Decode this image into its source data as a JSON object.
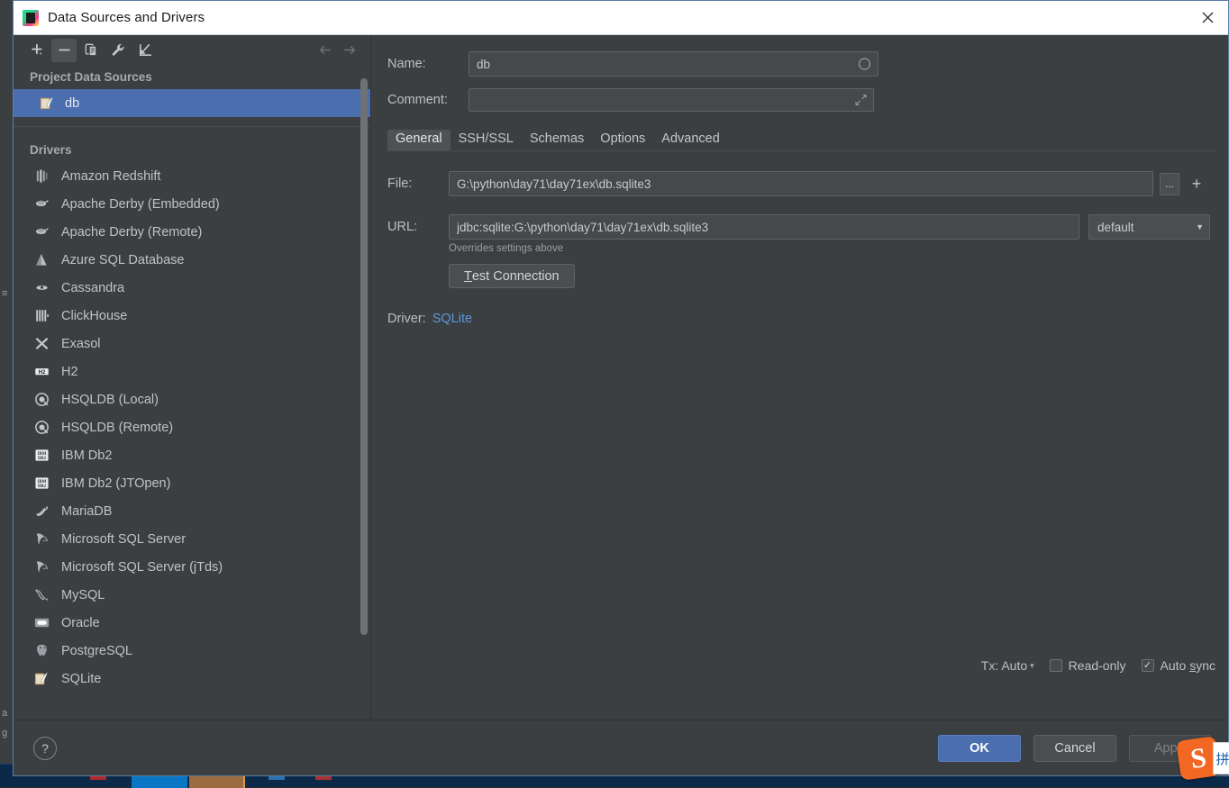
{
  "window": {
    "title": "Data Sources and Drivers",
    "app_icon": "pycharm-icon",
    "close_icon": "close-icon"
  },
  "toolbar": {
    "buttons": [
      {
        "name": "add-data-source-button",
        "icon": "plus-icon",
        "label": "+"
      },
      {
        "name": "remove-data-source-button",
        "icon": "minus-icon",
        "label": "−"
      },
      {
        "name": "duplicate-data-source-button",
        "icon": "copy-icon",
        "label": "copy"
      },
      {
        "name": "properties-button",
        "icon": "wrench-icon",
        "label": "wrench"
      },
      {
        "name": "import-data-source-button",
        "icon": "import-arrow-icon",
        "label": "import"
      }
    ],
    "back_icon": "arrow-left-icon",
    "forward_icon": "arrow-right-icon"
  },
  "sidebar": {
    "project_group_label": "Project Data Sources",
    "data_sources": [
      {
        "label": "db",
        "icon": "sqlite-icon",
        "selected": true
      }
    ],
    "drivers_group_label": "Drivers",
    "drivers": [
      {
        "label": "Amazon Redshift",
        "icon": "redshift-icon"
      },
      {
        "label": "Apache Derby (Embedded)",
        "icon": "derby-icon"
      },
      {
        "label": "Apache Derby (Remote)",
        "icon": "derby-icon"
      },
      {
        "label": "Azure SQL Database",
        "icon": "azure-icon"
      },
      {
        "label": "Cassandra",
        "icon": "cassandra-icon"
      },
      {
        "label": "ClickHouse",
        "icon": "clickhouse-icon"
      },
      {
        "label": "Exasol",
        "icon": "exasol-icon"
      },
      {
        "label": "H2",
        "icon": "h2-icon"
      },
      {
        "label": "HSQLDB (Local)",
        "icon": "hsqldb-icon"
      },
      {
        "label": "HSQLDB (Remote)",
        "icon": "hsqldb-icon"
      },
      {
        "label": "IBM Db2",
        "icon": "db2-icon"
      },
      {
        "label": "IBM Db2 (JTOpen)",
        "icon": "db2-icon"
      },
      {
        "label": "MariaDB",
        "icon": "mariadb-icon"
      },
      {
        "label": "Microsoft SQL Server",
        "icon": "mssql-icon"
      },
      {
        "label": "Microsoft SQL Server (jTds)",
        "icon": "mssql-icon"
      },
      {
        "label": "MySQL",
        "icon": "mysql-icon"
      },
      {
        "label": "Oracle",
        "icon": "oracle-icon"
      },
      {
        "label": "PostgreSQL",
        "icon": "postgresql-icon"
      },
      {
        "label": "SQLite",
        "icon": "sqlite-icon"
      }
    ]
  },
  "form": {
    "name_label": "Name:",
    "name_value": "db",
    "name_placeholder": "",
    "comment_label": "Comment:",
    "comment_value": "",
    "comment_placeholder": "",
    "tabs": [
      {
        "label": "General",
        "active": true
      },
      {
        "label": "SSH/SSL",
        "active": false
      },
      {
        "label": "Schemas",
        "active": false
      },
      {
        "label": "Options",
        "active": false
      },
      {
        "label": "Advanced",
        "active": false
      }
    ],
    "file_label": "File:",
    "file_value": "G:\\python\\day71\\day71ex\\db.sqlite3",
    "file_browse_label": "...",
    "file_add_label": "+",
    "url_label": "URL:",
    "url_value": "jdbc:sqlite:G:\\python\\day71\\day71ex\\db.sqlite3",
    "url_mode_value": "default",
    "url_hint": "Overrides settings above",
    "test_connection_label": "Test Connection",
    "test_connection_mnemonic": "T",
    "driver_label": "Driver:",
    "driver_value": "SQLite",
    "driver_link_color": "#5c96dc"
  },
  "status": {
    "tx_label": "Tx: Auto",
    "read_only_label": "Read-only",
    "read_only_checked": false,
    "auto_sync_label": "Auto sync",
    "auto_sync_mnemonic": "s",
    "auto_sync_checked": true,
    "checked_mark": "✓"
  },
  "footer": {
    "help_label": "?",
    "ok_label": "OK",
    "cancel_label": "Cancel",
    "apply_label": "Apply",
    "ok_color": "#4b6eaf"
  },
  "overlay": {
    "ime_logo_letter": "S",
    "ime_logo_color": "#f26722",
    "ime_side_glyph": "拼"
  }
}
